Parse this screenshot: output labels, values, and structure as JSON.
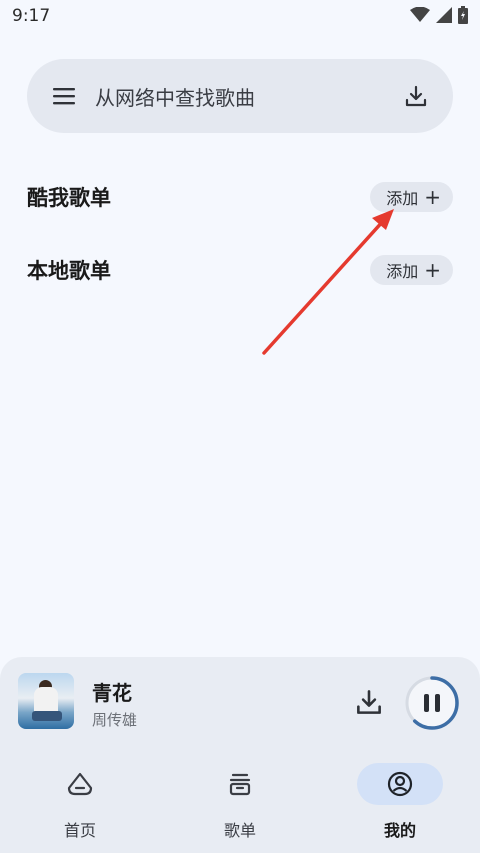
{
  "status_bar": {
    "time": "9:17",
    "icons": [
      "wifi-icon",
      "signal-icon",
      "battery-icon"
    ]
  },
  "search": {
    "placeholder": "从网络中查找歌曲",
    "menu_icon": "menu-icon",
    "download_icon": "download-icon"
  },
  "sections": [
    {
      "title": "酷我歌单",
      "add_label": "添加"
    },
    {
      "title": "本地歌单",
      "add_label": "添加"
    }
  ],
  "player": {
    "title": "青花",
    "artist": "周传雄",
    "progress": 0.62,
    "accent": "#3d6ea6"
  },
  "nav": {
    "items": [
      {
        "label": "首页",
        "icon": "home-icon",
        "active": false
      },
      {
        "label": "歌单",
        "icon": "playlist-icon",
        "active": false
      },
      {
        "label": "我的",
        "icon": "profile-icon",
        "active": true
      }
    ]
  },
  "colors": {
    "background": "#f5f8fe",
    "surface": "#e4e8f0",
    "nav_active": "#d3e1f7",
    "annotation": "#e53a2f"
  }
}
